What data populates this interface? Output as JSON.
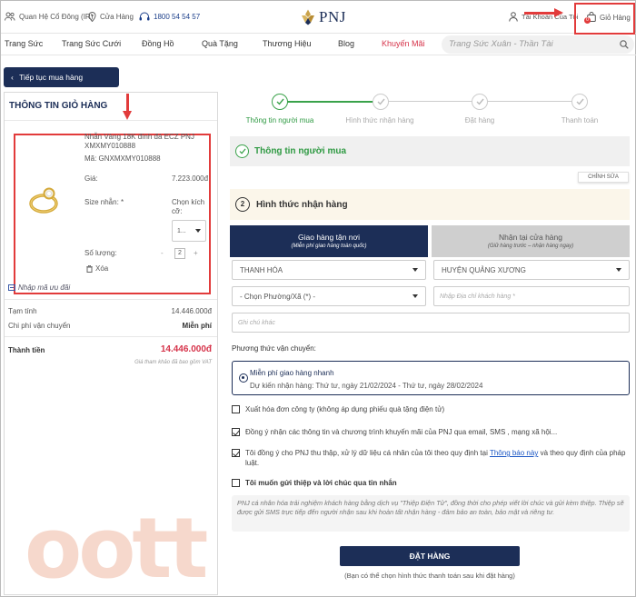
{
  "topbar": {
    "investor": "Quan Hệ Cổ Đông (IR)",
    "stores": "Cửa Hàng",
    "hotline": "1800 54 54 57",
    "brand": "PNJ",
    "account": "Tài Khoản Của Tôi",
    "cart": "Giỏ Hàng",
    "cart_count": "0"
  },
  "nav": [
    "Trang Sức",
    "Trang Sức Cưới",
    "Đồng Hồ",
    "Quà Tặng",
    "Thương Hiệu",
    "Blog",
    "Khuyến Mãi"
  ],
  "search_placeholder": "Trang Sức Xuân - Thần Tài",
  "back_label": "Tiếp tục mua hàng",
  "cart": {
    "title": "THÔNG TIN GIỎ HÀNG",
    "product_name": "Nhẫn Vàng 18K đính đá ECZ PNJ XMXMY010888",
    "product_code": "Mã: GNXMXMY010888",
    "price_label": "Giá:",
    "price": "7.223.000đ",
    "size_label": "Size nhẫn: *",
    "size_choose": "Chọn kích cỡ:",
    "size_value": "1...",
    "qty_label": "Số lượng:",
    "qty_value": "2",
    "qty_minus": "-",
    "qty_plus": "+",
    "delete": "Xóa",
    "coupon": "Nhập mã ưu đãi",
    "subtotal_label": "Tạm tính",
    "subtotal": "14.446.000đ",
    "ship_label": "Chi phí vận chuyển",
    "ship": "Miễn phí",
    "total_label": "Thành tiền",
    "total": "14.446.000đ",
    "vat": "Giá tham khảo đã bao gồm VAT"
  },
  "steps": [
    "Thông tin người mua",
    "Hình thức nhận hàng",
    "Đặt hàng",
    "Thanh toán"
  ],
  "buyer": {
    "title": "Thông tin người mua",
    "edit": "CHỈNH SỬA"
  },
  "receive": {
    "num": "2",
    "title": "Hình thức nhận hàng",
    "delivery": "Giao hàng tận nơi",
    "delivery_sub": "(Miễn phí giao hàng toàn quốc)",
    "pickup": "Nhận tại cửa hàng",
    "pickup_sub": "(Giữ hàng trước – nhận hàng ngay)"
  },
  "address": {
    "province": "THANH HÓA",
    "district": "HUYỆN QUẢNG XƯƠNG",
    "ward": "- Chọn Phường/Xã (*) -",
    "street_ph": "Nhập Địa chỉ khách hàng *",
    "note_ph": "Ghi chú khác"
  },
  "shipping": {
    "label": "Phương thức vận chuyển:",
    "option": "Miễn phí giao hàng nhanh",
    "eta": "Dự kiến nhận hàng: Thứ tư, ngày 21/02/2024 - Thứ tư, ngày 28/02/2024"
  },
  "checks": {
    "invoice": "Xuất hóa đơn công ty (không áp dụng phiếu quà tặng điện tử)",
    "promo": "Đồng ý nhận các thông tin và chương trình khuyến mãi của PNJ qua email, SMS , mạng xã hội...",
    "privacy_a": "Tôi đồng ý cho PNJ thu thập, xử lý dữ liệu cá nhân của tôi theo quy định tại",
    "privacy_link": "Thông báo này",
    "privacy_b": "và theo quy định của pháp luật.",
    "card": "Tôi muốn gửi thiệp và lời chúc qua tin nhắn"
  },
  "card_note": "PNJ cá nhân hóa trải nghiệm khách hàng bằng dịch vụ \"Thiệp Điện Tử\", đồng thời cho phép viết lời chúc và gửi kèm thiệp. Thiệp sẽ được gửi SMS trực tiếp đến người nhận sau khi hoàn tất nhận hàng - đảm bảo an toàn, bảo mật và riêng tư.",
  "order_btn": "ĐẶT HÀNG",
  "order_note": "(Bạn có thể chọn hình thức thanh toán sau khi đặt hàng)",
  "watermark": "oott",
  "colors": {
    "navy": "#1c2e57",
    "green": "#3aa24a",
    "red": "#e23b3b",
    "promo": "#d6334a"
  }
}
